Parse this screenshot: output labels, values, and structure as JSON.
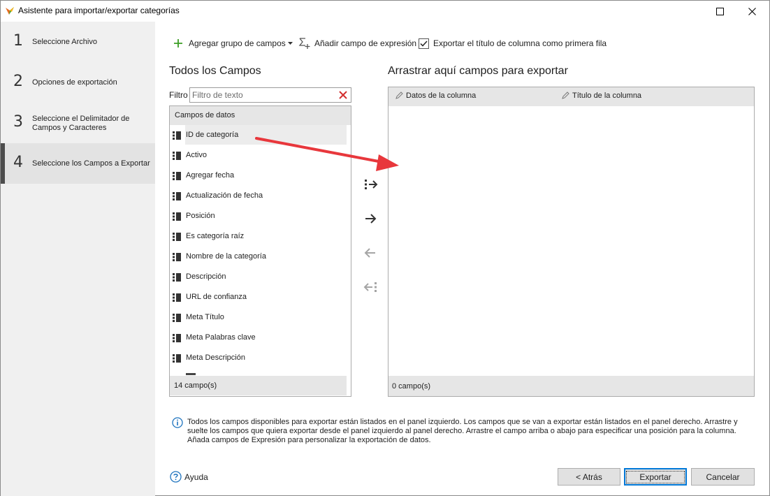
{
  "window": {
    "title": "Asistente para importar/exportar categorías"
  },
  "steps": [
    {
      "num": "1",
      "label": "Seleccione Archivo"
    },
    {
      "num": "2",
      "label": "Opciones de exportación"
    },
    {
      "num": "3",
      "label": "Seleccione el Delimitador de Campos y Caracteres"
    },
    {
      "num": "4",
      "label": "Seleccione los Campos a Exportar"
    }
  ],
  "toolbar": {
    "add_group": "Agregar grupo de campos",
    "add_expression": "Añadir campo de expresión",
    "export_title_checkbox": "Exportar el título de columna como primera fila",
    "export_title_checked": true
  },
  "left_panel": {
    "heading": "Todos los Campos",
    "filter_label": "Filtro",
    "filter_placeholder": "Filtro de texto",
    "group_header": "Campos de datos",
    "fields": [
      "ID de categoría",
      "Activo",
      "Agregar fecha",
      "Actualización de fecha",
      "Posición",
      "Es categoría raíz",
      "Nombre de la categoría",
      "Descripción",
      "URL de confianza",
      "Meta Título",
      "Meta Palabras clave",
      "Meta Descripción"
    ],
    "count": "14 campo(s)"
  },
  "right_panel": {
    "heading": "Arrastrar aquí campos para exportar",
    "col_data": "Datos de la columna",
    "col_title": "Título de la columna",
    "count": "0 campo(s)"
  },
  "info": {
    "text": "Todos los campos disponibles para exportar están listados en el panel izquierdo. Los campos que se van a exportar están listados en el panel derecho. Arrastre y suelte los campos que quiera exportar desde el panel izquierdo al panel derecho. Arrastre el campo arriba o abajo para especificar una posición para la columna. Añada campos de Expresión para personalizar la exportación de datos."
  },
  "footer": {
    "help": "Ayuda",
    "back": "< Atrás",
    "export": "Exportar",
    "cancel": "Cancelar"
  },
  "colors": {
    "arrow": "#e8373c",
    "clear_x": "#d32f2f",
    "add_plus": "#3a9d23",
    "info_blue": "#1e73be"
  }
}
